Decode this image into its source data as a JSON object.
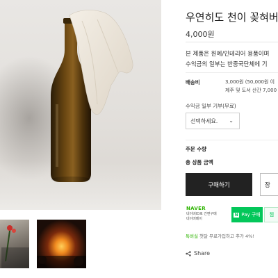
{
  "product": {
    "title": "우연히도 천이 꽂혀버",
    "price": "4,000원",
    "description_line1": "본 제품은 원예/인테리어 용품이며",
    "description_line2": "수익금의 일부는 반중국단체에 기"
  },
  "shipping": {
    "label": "배송비",
    "line1": "3,000원 (50,000원 이",
    "line2": "제주 및 도서 산간 7,000"
  },
  "option": {
    "label": "수익금 일부 기부(무료)",
    "selected": "선택하세요.",
    "chevron_icon": "chevron-down-icon"
  },
  "order": {
    "qty_label": "주문 수량",
    "total_label": "총 상품 금액"
  },
  "actions": {
    "buy_label": "구매하기",
    "cart_label": "장"
  },
  "naver": {
    "logo": "NAVER",
    "sub_line1": "네이버ID로 간편구매",
    "sub_line2": "네이버페이",
    "pay_label": "Pay 구매",
    "side_label": "찜",
    "brand_color": "#03c75a"
  },
  "points": {
    "highlight": "톡버실",
    "text": " 첫달 무료가입하고 추가 4%!"
  },
  "share": {
    "label": "Share",
    "icon": "share-icon"
  }
}
